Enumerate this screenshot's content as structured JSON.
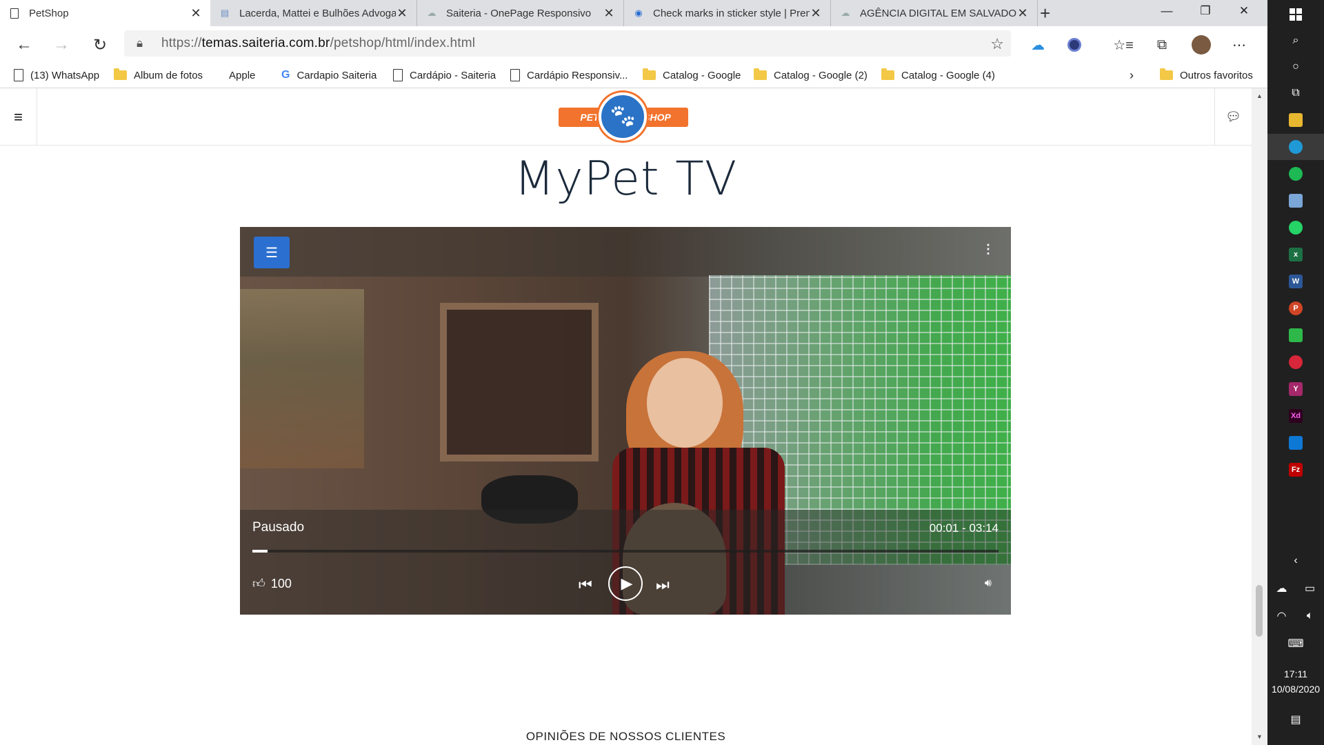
{
  "browser": {
    "tabs": [
      {
        "title": "PetShop",
        "active": true
      },
      {
        "title": "Lacerda, Mattei e Bulhões Advogados",
        "active": false
      },
      {
        "title": "Saiteria - OnePage Responsivo",
        "active": false
      },
      {
        "title": "Check marks in sticker style | Premium",
        "active": false
      },
      {
        "title": "AGÊNCIA DIGITAL EM SALVADOR",
        "active": false
      }
    ],
    "url_prefix": "https://",
    "url_domain": "temas.saiteria.com.br",
    "url_path": "/petshop/html/index.html",
    "bookmarks": [
      "(13) WhatsApp",
      "Album de fotos",
      "Apple",
      "Cardapio Saiteria",
      "Cardápio - Saiteria",
      "Cardápio Responsiv...",
      "Catalog - Google",
      "Catalog - Google (2)",
      "Catalog - Google (4)"
    ],
    "other_favorites": "Outros favoritos"
  },
  "site": {
    "logo_left": "PET",
    "logo_right": "SHOP",
    "title": "MyPet TV",
    "section_heading": "OPINIÕES DE NOSSOS CLIENTES"
  },
  "player": {
    "status": "Pausado",
    "time": "00:01 - 03:14",
    "likes": "100",
    "progress": 0.002
  },
  "taskbar": {
    "time": "17:11",
    "date": "10/08/2020"
  }
}
